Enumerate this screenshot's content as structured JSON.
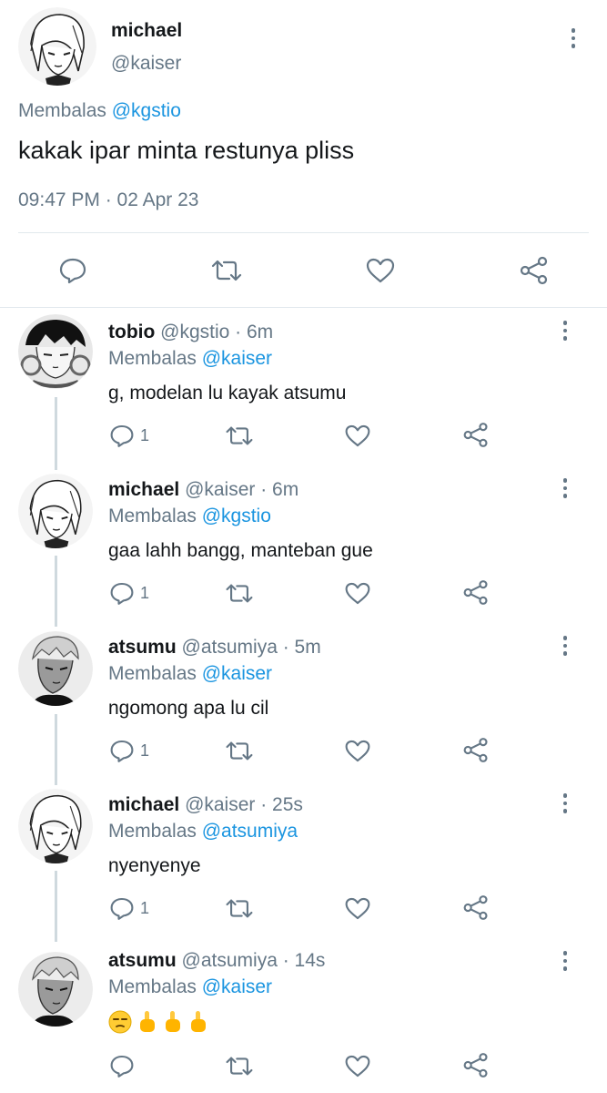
{
  "main_tweet": {
    "name": "michael",
    "handle": "@kaiser",
    "replying_prefix": "Membalas",
    "replying_to": "@kgstio",
    "text": "kakak ipar minta restunya pliss",
    "timestamp": "09:47 PM · 02 Apr 23",
    "actions": [
      "reply-icon",
      "retweet-icon",
      "like-icon",
      "share-icon"
    ]
  },
  "replies": [
    {
      "name": "tobio",
      "meta": "@kgstio · 6m",
      "replying_prefix": "Membalas",
      "replying_to": "@kaiser",
      "text": "g, modelan lu kayak atsumu",
      "reply_count": "1",
      "avatar": "tobio-avatar"
    },
    {
      "name": "michael",
      "meta": "@kaiser · 6m",
      "replying_prefix": "Membalas",
      "replying_to": "@kgstio",
      "text": "gaa lahh bangg, manteban gue",
      "reply_count": "1",
      "avatar": "michael-avatar"
    },
    {
      "name": "atsumu",
      "meta": "@atsumiya · 5m",
      "replying_prefix": "Membalas",
      "replying_to": "@kaiser",
      "text": "ngomong apa lu cil",
      "reply_count": "1",
      "avatar": "atsumu-avatar"
    },
    {
      "name": "michael",
      "meta": "@kaiser · 25s",
      "replying_prefix": "Membalas",
      "replying_to": "@atsumiya",
      "text": "nyenyenye",
      "reply_count": "1",
      "avatar": "michael-avatar"
    },
    {
      "name": "atsumu",
      "meta": "@atsumiya · 14s",
      "replying_prefix": "Membalas",
      "replying_to": "@kaiser",
      "text": "",
      "emojis": [
        "unamused-face-emoji",
        "middle-finger-emoji",
        "middle-finger-emoji",
        "middle-finger-emoji"
      ],
      "reply_count": "",
      "avatar": "atsumu-avatar"
    }
  ],
  "colors": {
    "text": "#14171a",
    "secondary": "#657786",
    "link": "#1b95e0",
    "divider": "#e1e8ed",
    "thread_line": "#cfd9de"
  }
}
